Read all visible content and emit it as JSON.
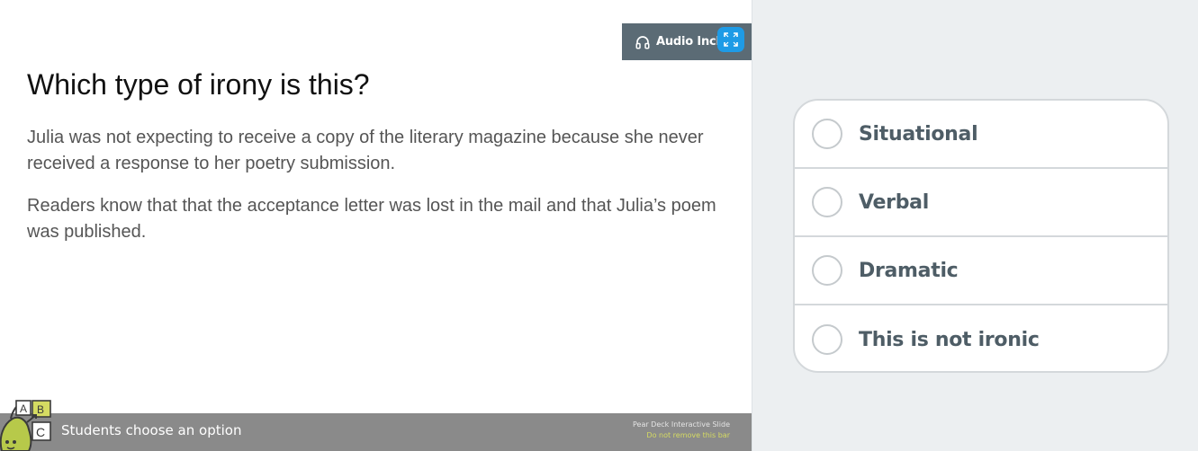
{
  "slide": {
    "audio_badge": "Audio Inclu",
    "question": "Which type of irony is this?",
    "paragraphs": [
      "Julia was not expecting to receive a copy of the literary magazine because she never received a response to her poetry submission.",
      "Readers know that that the acceptance letter was lost in the mail and that Julia’s poem was published."
    ],
    "footer": {
      "label": "Students choose an option",
      "note_line1": "Pear Deck Interactive Slide",
      "note_line2": "Do not remove this bar"
    },
    "mascot_letters": [
      "A",
      "B",
      "C"
    ]
  },
  "options": [
    {
      "label": "Situational",
      "selected": false
    },
    {
      "label": "Verbal",
      "selected": false
    },
    {
      "label": "Dramatic",
      "selected": false
    },
    {
      "label": "This is not ironic",
      "selected": false
    }
  ],
  "colors": {
    "panel_bg": "#eceff1",
    "badge_bg": "#5b6b75",
    "expand_button": "#1e9be6",
    "footer_bg": "#8a8a8a",
    "option_text": "#4e5d66",
    "note_highlight": "#d5db62"
  },
  "icons": {
    "audio": "headphones-icon",
    "expand": "expand-icon",
    "radio": "radio-circle-icon"
  }
}
